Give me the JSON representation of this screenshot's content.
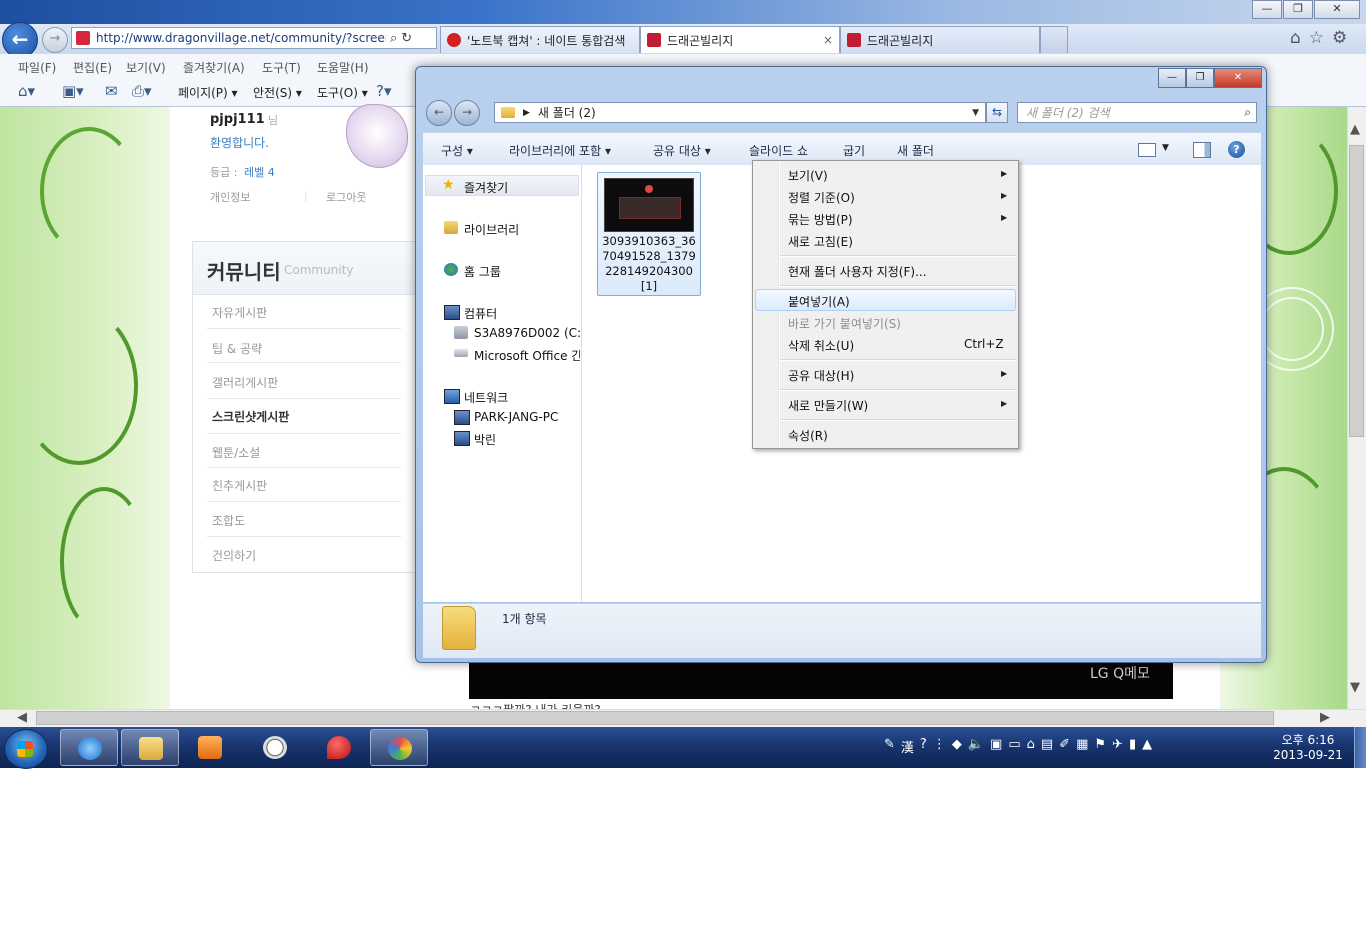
{
  "browser": {
    "window_buttons": [
      "—",
      "❐",
      "✕"
    ],
    "url": "http://www.dragonvillage.net/community/?screensho",
    "tabs": [
      {
        "label": "'노트북 캡쳐' : 네이트 통합검색"
      },
      {
        "label": "드래곤빌리지",
        "close": "×"
      },
      {
        "label": "드래곤빌리지"
      }
    ],
    "menu": [
      "파일(F)",
      "편집(E)",
      "보기(V)",
      "즐겨찾기(A)",
      "도구(T)",
      "도움말(H)"
    ],
    "commands": {
      "page": "페이지(P)",
      "safety": "안전(S)",
      "tools": "도구(O)"
    }
  },
  "site": {
    "username": "pjpj111",
    "username_suffix": "님",
    "welcome": "환영합니다.",
    "grade_label": "등급 :",
    "grade_value": "레벨 4",
    "my_info": "개인정보",
    "logout": "로그아웃",
    "community_title": "커뮤니티",
    "community_sub": "Community",
    "community_items": [
      "자유게시판",
      "팁 & 공략",
      "갤러리게시판",
      "스크린샷게시판",
      "웹툰/소설",
      "친추게시판",
      "조합도",
      "건의하기"
    ],
    "banner_text": "LG Q메모",
    "cut_text": "ㅋㅋㅋ팔까? 내가 키울까?"
  },
  "explorer": {
    "path": "새 폴더 (2)",
    "search_placeholder": "새 폴더 (2) 검색",
    "toolbar": [
      "구성",
      "라이브러리에 포함",
      "공유 대상",
      "슬라이드 쇼",
      "굽기",
      "새 폴더"
    ],
    "nav": {
      "favorites": "즐겨찾기",
      "libraries": "라이브러리",
      "homegroup": "홈 그룹",
      "computer": "컴퓨터",
      "drive_c": "S3A8976D002 (C:)",
      "office": "Microsoft Office 간",
      "network": "네트워크",
      "pc1": "PARK-JANG-PC",
      "pc2": "박린"
    },
    "file_name": "3093910363_3670491528_1379228149204300[1]",
    "item_count": "1개 항목"
  },
  "context_menu": {
    "view": "보기(V)",
    "sort_by": "정렬 기준(O)",
    "group_by": "묶는 방법(P)",
    "refresh": "새로 고침(E)",
    "customize": "현재 폴더 사용자 지정(F)...",
    "paste": "붙여넣기(A)",
    "paste_shortcut": "바로 가기 붙여넣기(S)",
    "undo_delete": "삭제 취소(U)",
    "undo_shortcut": "Ctrl+Z",
    "share_with": "공유 대상(H)",
    "new": "새로 만들기(W)",
    "properties": "속성(R)"
  },
  "taskbar": {
    "tray_ime": "漢",
    "time": "오후 6:16",
    "date": "2013-09-21"
  }
}
